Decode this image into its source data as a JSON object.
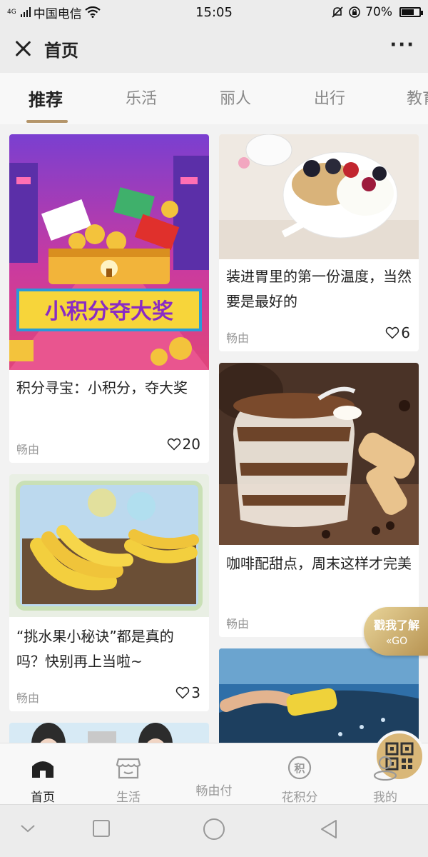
{
  "status": {
    "network": "4G",
    "carrier": "中国电信",
    "time": "15:05",
    "battery": "70%",
    "battery_level": 0.7
  },
  "titlebar": {
    "title": "首页"
  },
  "tabs": [
    {
      "label": "推荐",
      "active": true
    },
    {
      "label": "乐活"
    },
    {
      "label": "丽人"
    },
    {
      "label": "出行"
    },
    {
      "label": "教育"
    }
  ],
  "cards": [
    {
      "title": "积分寻宝：小积分，夺大奖",
      "source": "畅由",
      "likes": "20",
      "banner_text": "小积分夺大奖"
    },
    {
      "title": "装进胃里的第一份温度，当然要是最好的",
      "source": "畅由",
      "likes": "6"
    },
    {
      "title": "“挑水果小秘诀”都是真的吗？快别再上当啦~",
      "source": "畅由",
      "likes": "3"
    },
    {
      "title": "咖啡配甜点，周末这样才完美",
      "source": "畅由"
    }
  ],
  "float_button": {
    "label": "戳我了解",
    "go": "«GO"
  },
  "bottom_nav": [
    {
      "label": "首页",
      "icon": "home-icon",
      "active": true
    },
    {
      "label": "生活",
      "icon": "shop-icon"
    },
    {
      "label": "畅由付",
      "icon": "qr-code-icon"
    },
    {
      "label": "花积分",
      "icon": "points-icon",
      "glyph": "积"
    },
    {
      "label": "我的",
      "icon": "user-icon"
    }
  ],
  "colors": {
    "accent": "#b4956a",
    "pay_button": "#d9b778"
  }
}
